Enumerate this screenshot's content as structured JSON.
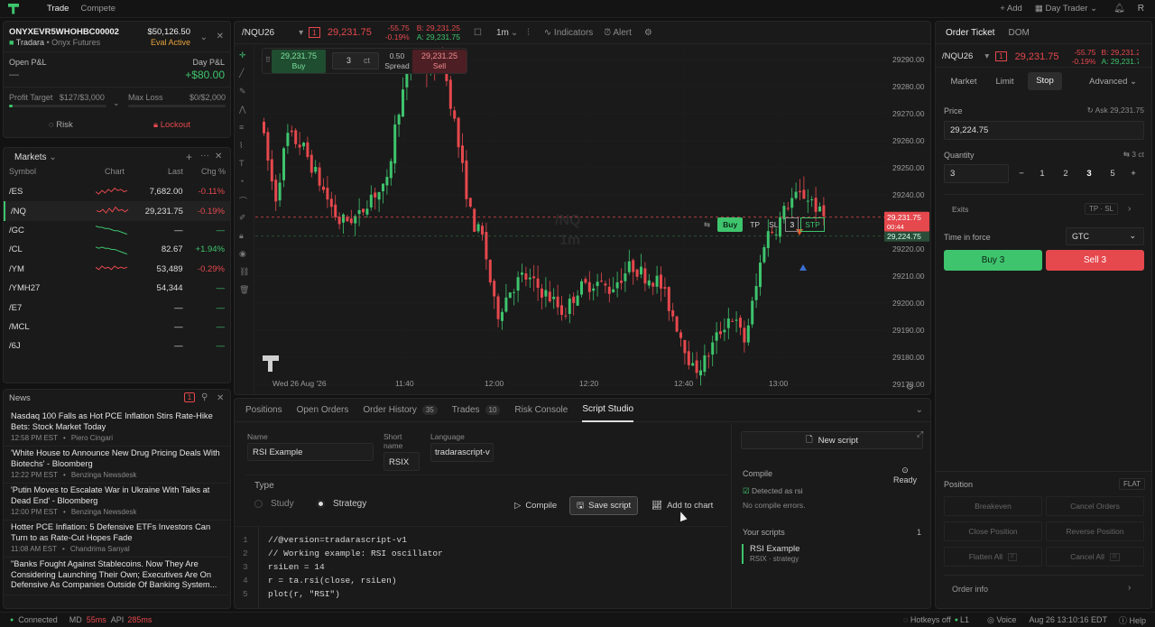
{
  "topbar": {
    "tabs": [
      "Trade",
      "Compete"
    ],
    "add": "Add",
    "mode": "Day Trader",
    "avatar": "R"
  },
  "account": {
    "id": "ONYXEVR5WHOHBC00002",
    "org": "Tradara",
    "firm": "Onyx Futures",
    "balance": "$50,126.50",
    "status": "Eval Active",
    "open_pnl_label": "Open P&L",
    "open_pnl": "—",
    "day_pnl_label": "Day P&L",
    "day_pnl": "+$80.00",
    "profit_target_label": "Profit Target",
    "profit_target": "$127/$3,000",
    "profit_progress": 0.04,
    "max_loss_label": "Max Loss",
    "max_loss": "$0/$2,000",
    "risk": "Risk",
    "lockout": "Lockout"
  },
  "markets": {
    "title": "Markets",
    "cols": [
      "Symbol",
      "Chart",
      "Last",
      "Chg %"
    ],
    "rows": [
      {
        "sym": "/ES",
        "last": "7,682.00",
        "chg": "-0.11%",
        "dir": "r"
      },
      {
        "sym": "/NQ",
        "last": "29,231.75",
        "chg": "-0.19%",
        "dir": "r"
      },
      {
        "sym": "/GC",
        "last": "—",
        "chg": "—",
        "dir": "g"
      },
      {
        "sym": "/CL",
        "last": "82.67",
        "chg": "+1.94%",
        "dir": "g"
      },
      {
        "sym": "/YM",
        "last": "53,489",
        "chg": "-0.29%",
        "dir": "r"
      },
      {
        "sym": "/YMH27",
        "last": "54,344",
        "chg": "—",
        "dir": "g"
      },
      {
        "sym": "/E7",
        "last": "—",
        "chg": "—",
        "dir": "g"
      },
      {
        "sym": "/MCL",
        "last": "—",
        "chg": "—",
        "dir": "g"
      },
      {
        "sym": "/6J",
        "last": "—",
        "chg": "—",
        "dir": "g"
      }
    ]
  },
  "news": {
    "title": "News",
    "badge": "1",
    "items": [
      {
        "head": "Nasdaq 100 Falls as Hot PCE Inflation Stirs Rate-Hike Bets: Stock Market Today",
        "time": "12:58 PM EST",
        "src": "Piero Cingari"
      },
      {
        "head": "'White House to Announce New Drug Pricing Deals With Biotechs' - Bloomberg",
        "time": "12:22 PM EST",
        "src": "Benzinga Newsdesk"
      },
      {
        "head": "'Putin Moves to Escalate War in Ukraine With Talks at Dead End' - Bloomberg",
        "time": "12:00 PM EST",
        "src": "Benzinga Newsdesk"
      },
      {
        "head": "Hotter PCE Inflation: 5 Defensive ETFs Investors Can Turn to as Rate-Cut Hopes Fade",
        "time": "11:08 AM EST",
        "src": "Chandrima Sanyal"
      },
      {
        "head": "\"Banks Fought Against Stablecoins. Now They Are Considering Launching Their Own; Executives Are On Defensive As Companies Outside Of Banking System...",
        "time": "",
        "src": ""
      }
    ]
  },
  "chart": {
    "symbol": "/NQU26",
    "qty_badge": "1",
    "last": "29,231.75",
    "chg": "-55.75",
    "chg_pct": "-0.19%",
    "bid": "B: 29,231.25",
    "ask": "A: 29,231.75",
    "interval": "1m",
    "indicators": "Indicators",
    "alert": "Alert",
    "buy_price": "29,231.75",
    "buy": "Buy",
    "sell_price": "29,231.25",
    "sell": "Sell",
    "spread": "0.50",
    "spread_label": "Spread",
    "qty": "3",
    "qty_unit": "ct",
    "watermark_sym": "/NQ",
    "watermark_int": "1m",
    "date_label": "Wed 26 Aug '26",
    "x_ticks": [
      "11:40",
      "12:00",
      "12:20",
      "12:40",
      "13:00"
    ],
    "y_ticks": [
      "29290.00",
      "29280.00",
      "29270.00",
      "29260.00",
      "29250.00",
      "29240.00",
      "29230.00",
      "29220.00",
      "29210.00",
      "29200.00",
      "29190.00",
      "29180.00",
      "29170.00"
    ],
    "price_tag": "29,231.75",
    "price_tag_time": "00:44",
    "bid_tag": "29,224.75",
    "order_bar": {
      "buy": "Buy",
      "tp": "TP",
      "sl": "SL",
      "qty": "3",
      "stp": "STP"
    }
  },
  "bottom": {
    "tabs": [
      {
        "label": "Positions",
        "count": ""
      },
      {
        "label": "Open Orders",
        "count": ""
      },
      {
        "label": "Order History",
        "count": "35"
      },
      {
        "label": "Trades",
        "count": "10"
      },
      {
        "label": "Risk Console",
        "count": ""
      },
      {
        "label": "Script Studio",
        "count": ""
      }
    ],
    "name_label": "Name",
    "name": "RSI Example",
    "short_label": "Short name",
    "short": "RSIX",
    "lang_label": "Language",
    "lang": "tradarascript-v",
    "type_label": "Type",
    "study": "Study",
    "strategy": "Strategy",
    "compile": "Compile",
    "save": "Save script",
    "add_chart": "Add to chart",
    "code": [
      "//@version=tradarascript-v1",
      "// Working example: RSI oscillator",
      "rsiLen = 14",
      "r = ta.rsi(close, rsiLen)",
      "plot(r, \"RSI\")"
    ],
    "new_script": "New script",
    "compile_label": "Compile",
    "ready": "Ready",
    "detected": "Detected as rsi",
    "no_errors": "No compile errors.",
    "your_scripts": "Your scripts",
    "scripts_count": "1",
    "script_name": "RSI Example",
    "script_short": "RSIX",
    "script_type": "strategy"
  },
  "ticket": {
    "tabs": [
      "Order Ticket",
      "DOM"
    ],
    "symbol": "/NQU26",
    "qty_badge": "1",
    "last": "29,231.75",
    "chg": "-55.75",
    "chg_pct": "-0.19%",
    "bid": "B: 29,231.25",
    "ask": "A: 29,231.75",
    "types": [
      "Market",
      "Limit",
      "Stop"
    ],
    "advanced": "Advanced",
    "price_label": "Price",
    "ask_label": "Ask 29,231.75",
    "price": "29,224.75",
    "qty_label": "Quantity",
    "qty_hint": "3 ct",
    "qty": "3",
    "qty_opts": [
      "1",
      "2",
      "3",
      "5"
    ],
    "exits": "Exits",
    "exits_val": "TP · SL",
    "tif_label": "Time in force",
    "tif": "GTC",
    "buy": "Buy 3",
    "sell": "Sell 3",
    "position_label": "Position",
    "position": "FLAT",
    "actions": [
      "Breakeven",
      "Cancel Orders",
      "Close Position",
      "Reverse Position",
      "Flatten All",
      "Cancel All"
    ],
    "order_info": "Order info"
  },
  "status": {
    "connected": "Connected",
    "md": "MD",
    "md_val": "55ms",
    "api": "API",
    "api_val": "285ms",
    "hotkeys": "Hotkeys off",
    "l1": "L1",
    "voice": "Voice",
    "datetime": "Aug 26 13:10:16 EDT",
    "help": "Help"
  },
  "colors": {
    "up": "#3ec46d",
    "down": "#e5484d",
    "bg": "#121212",
    "panel": "#1a1a1a"
  }
}
